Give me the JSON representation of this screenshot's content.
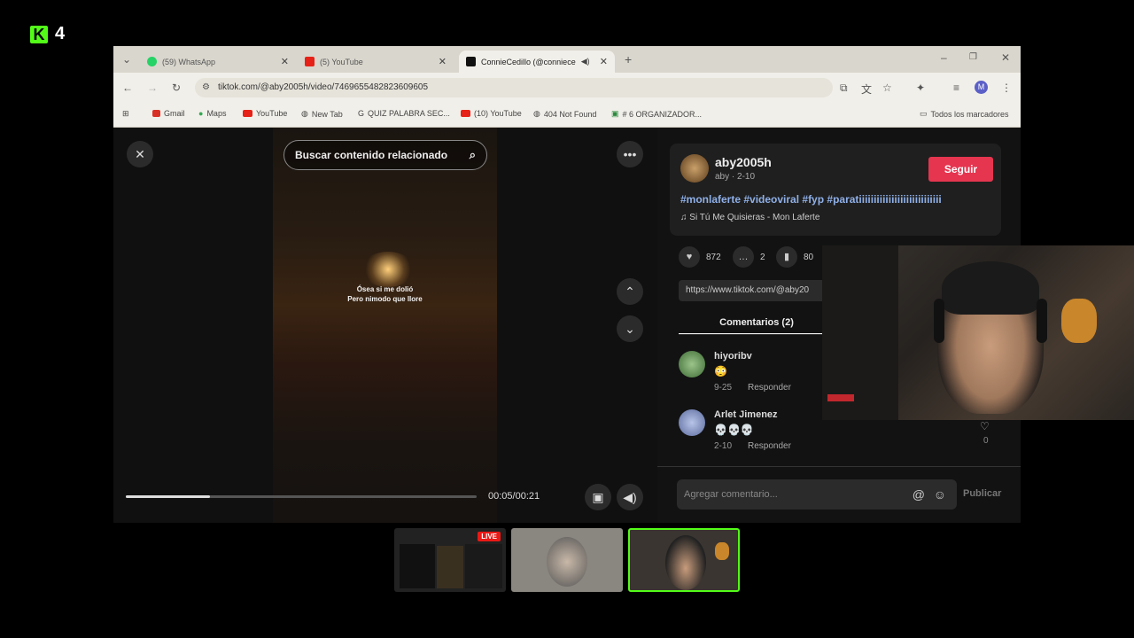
{
  "stream": {
    "logo_letter": "K",
    "viewer_count": "4"
  },
  "browser": {
    "tabs": [
      {
        "label": "(59) WhatsApp"
      },
      {
        "label": "(5) YouTube"
      },
      {
        "label": "ConnieCedillo (@conniece"
      }
    ],
    "new_tab_symbol": "+",
    "url": "tiktok.com/@aby2005h/video/7469655482823609605",
    "bookmarks": [
      {
        "label": "Gmail"
      },
      {
        "label": "Maps"
      },
      {
        "label": "YouTube"
      },
      {
        "label": "New Tab"
      },
      {
        "label": "QUIZ PALABRA SEC..."
      },
      {
        "label": "(10) YouTube"
      },
      {
        "label": "404 Not Found"
      },
      {
        "label": "# 6 ORGANIZADOR..."
      }
    ],
    "all_bookmarks": "Todos los marcadores",
    "profile_initial": "M"
  },
  "video": {
    "search_placeholder": "Buscar contenido relacionado",
    "caption_line1": "Ósea si me dolió",
    "caption_line2": "Pero nimodo que llore",
    "time": "00:05/00:21",
    "progress": 0.24
  },
  "post": {
    "username": "aby2005h",
    "subline": "aby · 2-10",
    "follow_label": "Seguir",
    "tags": "#monlaferte #videoviral #fyp #paratiiiiiiiiiiiiiiiiiiiiiiiiiiii",
    "music": "Si Tú Me Quisieras - Mon Laferte",
    "likes": "872",
    "comments": "2",
    "saves": "80",
    "link": "https://www.tiktok.com/@aby20",
    "comments_tab": "Comentarios (2)",
    "comment_list": [
      {
        "name": "hiyoribv",
        "text": "😳",
        "date": "9-25",
        "reply": "Responder"
      },
      {
        "name": "Arlet Jimenez",
        "text": "💀💀💀",
        "date": "2-10",
        "reply": "Responder",
        "likes": "0"
      }
    ],
    "comment_placeholder": "Agregar comentario...",
    "post_label": "Publicar"
  },
  "thumbnails": {
    "live_label": "LIVE"
  },
  "colors": {
    "accent": "#53fc18",
    "follow": "#e5354f",
    "live": "#e91916"
  }
}
